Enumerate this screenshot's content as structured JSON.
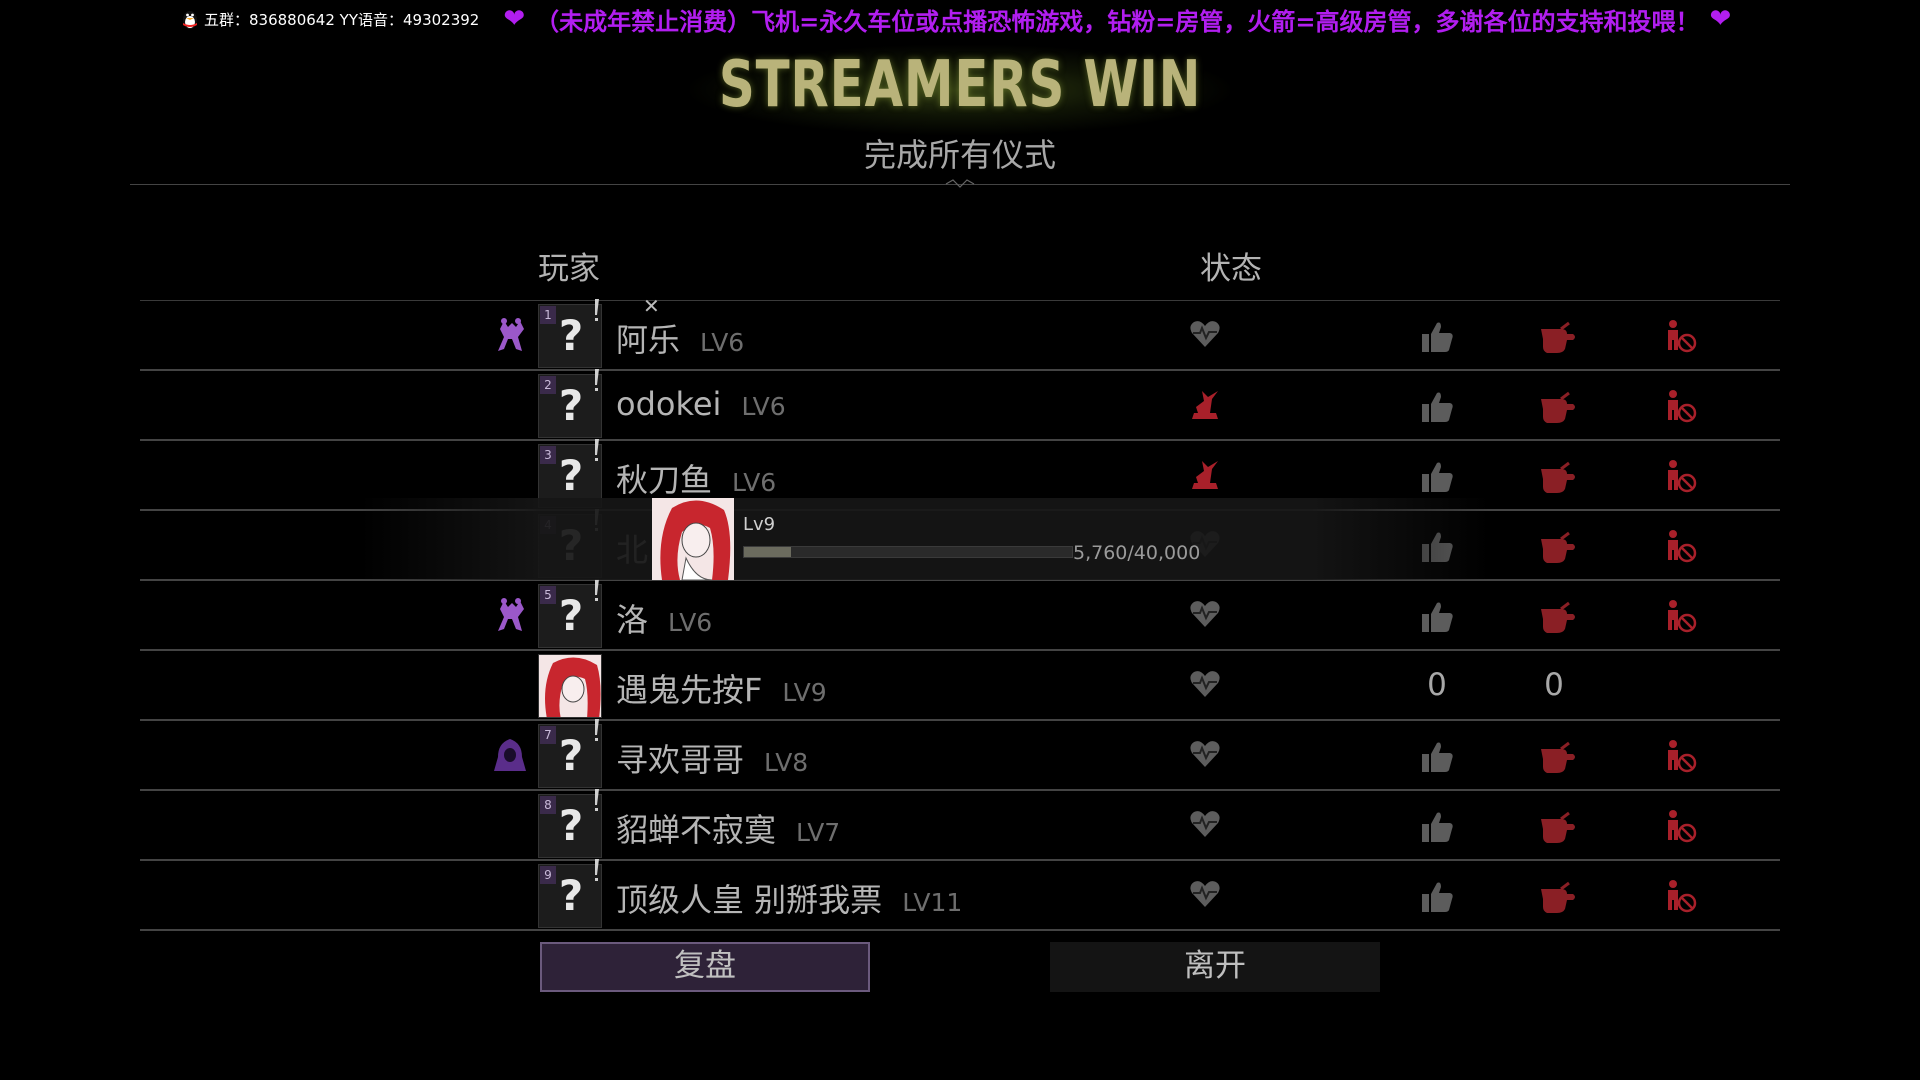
{
  "banner": {
    "contact": "五群：836880642  YY语音：49302392",
    "notice": "（未成年禁止消费）飞机=永久车位或点播恐怖游戏，钻粉=房管，火箭=高级房管，多谢各位的支持和投喂！",
    "heart_color": "#b21ef0"
  },
  "result": {
    "title": "STREAMERS WIN",
    "subtitle": "完成所有仪式"
  },
  "columns": {
    "player": "玩家",
    "status": "状态"
  },
  "players": [
    {
      "num": "1",
      "name": "阿乐",
      "level": "LV6",
      "status": "alive",
      "cosmetic": "dancers-icon",
      "avatar": "unknown"
    },
    {
      "num": "2",
      "name": "odokei",
      "level": "LV6",
      "status": "sacrificed",
      "cosmetic": "",
      "avatar": "unknown"
    },
    {
      "num": "3",
      "name": "秋刀鱼",
      "level": "LV6",
      "status": "sacrificed",
      "cosmetic": "",
      "avatar": "unknown"
    },
    {
      "num": "4",
      "name": "北",
      "level": "",
      "status": "alive",
      "cosmetic": "",
      "avatar": "unknown"
    },
    {
      "num": "5",
      "name": "洛",
      "level": "LV6",
      "status": "alive",
      "cosmetic": "dancers-icon",
      "avatar": "unknown"
    },
    {
      "num": "",
      "name": "遇鬼先按F",
      "level": "LV9",
      "status": "alive",
      "cosmetic": "",
      "avatar": "portrait",
      "likes": "0",
      "dislikes": "0"
    },
    {
      "num": "7",
      "name": "寻欢哥哥",
      "level": "LV8",
      "status": "alive",
      "cosmetic": "hooded-figure-icon",
      "avatar": "unknown"
    },
    {
      "num": "8",
      "name": "貂蝉不寂寞",
      "level": "LV7",
      "status": "alive",
      "cosmetic": "",
      "avatar": "unknown"
    },
    {
      "num": "9",
      "name": "顶级人皇 别掰我票",
      "level": "LV11",
      "status": "alive",
      "cosmetic": "",
      "avatar": "unknown"
    }
  ],
  "tooltip": {
    "level": "Lv9",
    "xp": "5,760/40,000",
    "progress": 0.144
  },
  "buttons": {
    "replay": "复盘",
    "leave": "离开"
  },
  "colors": {
    "title": "#b9b37a",
    "accent_red": "#a8202a",
    "replay_bg": "#2e2238"
  }
}
